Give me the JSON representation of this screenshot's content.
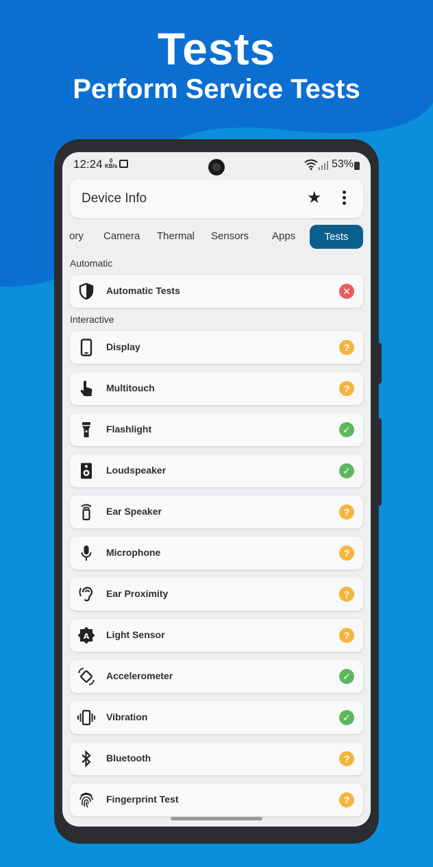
{
  "hero": {
    "title": "Tests",
    "subtitle": "Perform Service Tests"
  },
  "colors": {
    "background": "#0b8fdc",
    "accent": "#0c5f8c",
    "pass": "#5cb85c",
    "fail": "#e85d5d",
    "unknown": "#f5b53d"
  },
  "status_bar": {
    "time": "12:24",
    "net_speed": "0",
    "net_unit": "KB/s",
    "battery": "53%"
  },
  "app_bar": {
    "title": "Device Info",
    "favorite_icon": "star-icon",
    "menu_icon": "more-vert-icon"
  },
  "tabs": [
    {
      "label": "ory"
    },
    {
      "label": "Camera"
    },
    {
      "label": "Thermal"
    },
    {
      "label": "Sensors"
    },
    {
      "label": "Apps"
    },
    {
      "label": "Tests",
      "active": true
    }
  ],
  "sections": {
    "automatic": {
      "title": "Automatic",
      "items": [
        {
          "label": "Automatic Tests",
          "icon": "shield-icon",
          "status": "fail",
          "status_glyph": "✕"
        }
      ]
    },
    "interactive": {
      "title": "Interactive",
      "items": [
        {
          "label": "Display",
          "icon": "phone-icon",
          "status": "unknown",
          "status_glyph": "?"
        },
        {
          "label": "Multitouch",
          "icon": "touch-icon",
          "status": "unknown",
          "status_glyph": "?"
        },
        {
          "label": "Flashlight",
          "icon": "flashlight-icon",
          "status": "pass",
          "status_glyph": "✓"
        },
        {
          "label": "Loudspeaker",
          "icon": "speaker-icon",
          "status": "pass",
          "status_glyph": "✓"
        },
        {
          "label": "Ear Speaker",
          "icon": "ear-speaker-icon",
          "status": "unknown",
          "status_glyph": "?"
        },
        {
          "label": "Microphone",
          "icon": "microphone-icon",
          "status": "unknown",
          "status_glyph": "?"
        },
        {
          "label": "Ear Proximity",
          "icon": "ear-icon",
          "status": "unknown",
          "status_glyph": "?"
        },
        {
          "label": "Light Sensor",
          "icon": "light-sensor-icon",
          "status": "unknown",
          "status_glyph": "?"
        },
        {
          "label": "Accelerometer",
          "icon": "rotate-icon",
          "status": "pass",
          "status_glyph": "✓"
        },
        {
          "label": "Vibration",
          "icon": "vibration-icon",
          "status": "pass",
          "status_glyph": "✓"
        },
        {
          "label": "Bluetooth",
          "icon": "bluetooth-icon",
          "status": "unknown",
          "status_glyph": "?"
        },
        {
          "label": "Fingerprint Test",
          "icon": "fingerprint-icon",
          "status": "unknown",
          "status_glyph": "?"
        }
      ]
    }
  }
}
